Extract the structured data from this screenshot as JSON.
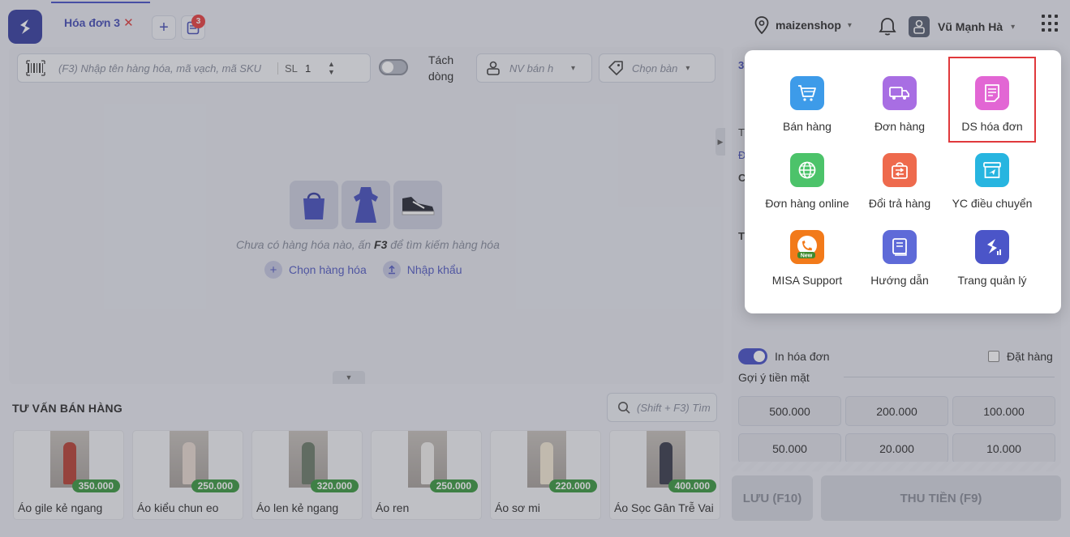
{
  "header": {
    "active_tab": "Hóa đơn 3",
    "close_glyph": "✕",
    "add_glyph": "+",
    "pending_badge": "3",
    "shop": "maizenshop",
    "user": "Vũ Mạnh Hà"
  },
  "search": {
    "placeholder": "(F3) Nhập tên hàng hóa, mã vạch, mã SKU",
    "qty_label": "SL",
    "qty_value": "1",
    "split_label": "Tách dòng",
    "staff_placeholder": "NV bán h",
    "table_placeholder": "Chọn bàn"
  },
  "empty_state": {
    "text_before": "Chưa có hàng hóa nào, ấn ",
    "key": "F3",
    "text_after": " để tìm kiếm hàng hóa",
    "choose_items": "Chọn hàng hóa",
    "import": "Nhập khẩu"
  },
  "advice": {
    "title": "TƯ VẤN BÁN HÀNG",
    "search_placeholder": "(Shift + F3) Tìm",
    "products": [
      {
        "name": "Áo gile kẻ ngang",
        "price": "350.000"
      },
      {
        "name": "Áo kiểu chun eo",
        "price": "250.000"
      },
      {
        "name": "Áo len kẻ ngang",
        "price": "320.000"
      },
      {
        "name": "Áo ren",
        "price": "250.000"
      },
      {
        "name": "Áo sơ mi",
        "price": "220.000"
      },
      {
        "name": "Áo Sọc Gân Trễ Vai",
        "price": "400.000"
      }
    ]
  },
  "checkout": {
    "print_invoice": "In hóa đơn",
    "order": "Đặt hàng",
    "cash_suggest": "Gợi ý tiền mặt",
    "amounts": [
      "500.000",
      "200.000",
      "100.000",
      "50.000",
      "20.000",
      "10.000"
    ],
    "save": "LƯU (F10)",
    "pay": "THU TIỀN (F9)"
  },
  "menu": {
    "items": [
      {
        "label": "Bán hàng",
        "icon": "cart-icon",
        "color": "#3d9be9"
      },
      {
        "label": "Đơn hàng",
        "icon": "truck-icon",
        "color": "#a86ee3"
      },
      {
        "label": "DS hóa đơn",
        "icon": "invoice-list-icon",
        "color": "#e266d4"
      },
      {
        "label": "Đơn hàng online",
        "icon": "globe-icon",
        "color": "#4cc36a"
      },
      {
        "label": "Đổi trả hàng",
        "icon": "return-bag-icon",
        "color": "#ee6a4d"
      },
      {
        "label": "YC điều chuyển",
        "icon": "transfer-box-icon",
        "color": "#27b5e0"
      },
      {
        "label": "MISA Support",
        "icon": "support-phone-icon",
        "color": "#f27a1a"
      },
      {
        "label": "Hướng dẫn",
        "icon": "guide-book-icon",
        "color": "#5e6ad8"
      },
      {
        "label": "Trang quản lý",
        "icon": "management-logo-icon",
        "color": "#4b55c8"
      }
    ]
  },
  "right_fragments": [
    "3",
    "T",
    "Đ",
    "C",
    "T"
  ]
}
